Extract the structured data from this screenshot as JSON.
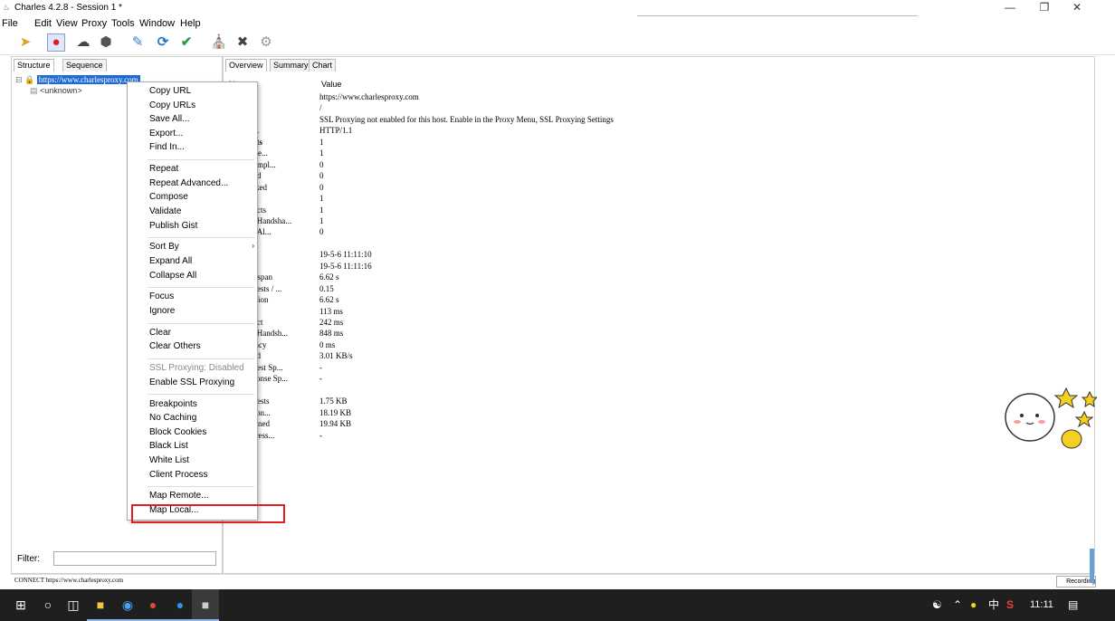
{
  "window": {
    "title": "Charles 4.2.8 - Session 1 *",
    "minimize_glyph": "—",
    "restore_glyph": "❐",
    "close_glyph": "✕"
  },
  "menubar": [
    "File",
    "Edit",
    "View",
    "Proxy",
    "Tools",
    "Window",
    "Help"
  ],
  "toolbar": {
    "icons": [
      "broom-icon",
      "record-icon",
      "throttle-icon",
      "breakpoint-icon",
      "pen-icon",
      "refresh-icon",
      "check-icon",
      "basket-icon",
      "tools-icon",
      "settings-icon"
    ]
  },
  "left_pane": {
    "tabs": [
      "Structure",
      "Sequence"
    ],
    "tree_root": "https://www.charlesproxy.com",
    "tree_child": "<unknown>",
    "filter_label": "Filter:"
  },
  "context_menu": {
    "groups": [
      [
        "Copy URL",
        "Copy URLs",
        "Save All...",
        "Export...",
        "Find In..."
      ],
      [
        "Repeat",
        "Repeat Advanced...",
        "Compose",
        "Validate",
        "Publish Gist"
      ],
      [
        "Sort By",
        "Expand All",
        "Collapse All"
      ],
      [
        "Focus",
        "Ignore"
      ],
      [
        "Clear",
        "Clear Others"
      ],
      [
        "SSL Proxying: Disabled",
        "Enable SSL Proxying"
      ],
      [
        "Breakpoints",
        "No Caching",
        "Block Cookies",
        "Black List",
        "White List",
        "Client Process"
      ],
      [
        "Map Remote...",
        "Map Local..."
      ]
    ],
    "disabled_item": "SSL Proxying: Disabled",
    "submenu_item": "Sort By",
    "submenu_glyph": "›"
  },
  "right_pane": {
    "tabs": [
      "Overview",
      "Summary",
      "Chart"
    ],
    "name_header": "N",
    "value_header": "Value",
    "rows": [
      {
        "name": "",
        "value": "https://www.charlesproxy.com",
        "bold": false
      },
      {
        "name": "h",
        "value": "/",
        "bold": false
      },
      {
        "name": "s",
        "value": "SSL Proxying not enabled for this host. Enable in the Proxy Menu, SSL Proxying Settings",
        "bold": false
      },
      {
        "name": "oc...",
        "value": "HTTP/1.1",
        "bold": false
      },
      {
        "name": "uests",
        "value": "1",
        "bold": true
      },
      {
        "name": "mple...",
        "value": "1",
        "bold": false
      },
      {
        "name": "ncompl...",
        "value": "0",
        "bold": false
      },
      {
        "name": "ailed",
        "value": "0",
        "bold": false
      },
      {
        "name": "locked",
        "value": "0",
        "bold": false
      },
      {
        "name": "NS",
        "value": "1",
        "bold": false
      },
      {
        "name": "nnects",
        "value": "1",
        "bold": false
      },
      {
        "name": "LS Handsha...",
        "value": "1",
        "bold": false
      },
      {
        "name": "ept Al...",
        "value": "0",
        "bold": false
      },
      {
        "name": "ing",
        "value": "",
        "bold": true
      },
      {
        "name": "tart",
        "value": "19-5-6 11:11:10",
        "bold": false
      },
      {
        "name": "nd",
        "value": "19-5-6 11:11:16",
        "bold": false
      },
      {
        "name": "imespan",
        "value": "6.62 s",
        "bold": false
      },
      {
        "name": "equests / ...",
        "value": "0.15",
        "bold": false
      },
      {
        "name": "uration",
        "value": "6.62 s",
        "bold": false
      },
      {
        "name": "NS",
        "value": "113 ms",
        "bold": false
      },
      {
        "name": "nnect",
        "value": "242 ms",
        "bold": false
      },
      {
        "name": "LS Handsh...",
        "value": "848 ms",
        "bold": false
      },
      {
        "name": "atency",
        "value": "0 ms",
        "bold": false
      },
      {
        "name": "peed",
        "value": "3.01 KB/s",
        "bold": false
      },
      {
        "name": "equest Sp...",
        "value": "-",
        "bold": false
      },
      {
        "name": "esponse Sp...",
        "value": "-",
        "bold": false
      },
      {
        "name": "e",
        "value": "",
        "bold": true
      },
      {
        "name": "equests",
        "value": "1.75 KB",
        "bold": false
      },
      {
        "name": "espon...",
        "value": "18.19 KB",
        "bold": false
      },
      {
        "name": "mbined",
        "value": "19.94 KB",
        "bold": false
      },
      {
        "name": "mpress...",
        "value": "-",
        "bold": false
      }
    ]
  },
  "statusbar": {
    "text": "CONNECT https://www.charlesproxy.com",
    "recording": "Recording"
  },
  "taskbar": {
    "time": "11:11",
    "ime": "中"
  },
  "colors": {
    "selection": "#1e6bd6",
    "highlight_box": "#e02020",
    "taskbar": "#1f1f1f"
  }
}
